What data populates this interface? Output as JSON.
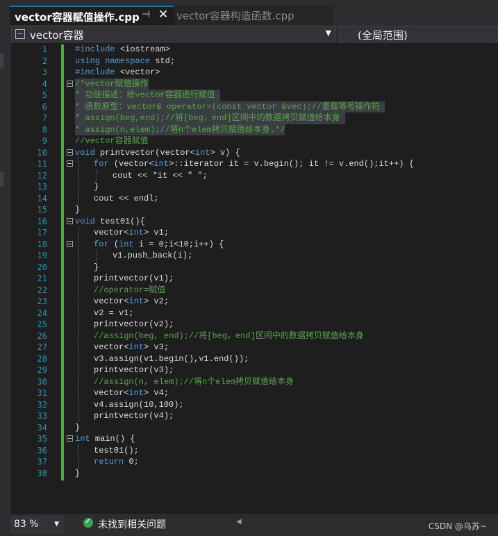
{
  "tabs": {
    "active": {
      "label": "vector容器赋值操作.cpp",
      "pin_icon": "pin-icon",
      "close_icon": "close-icon"
    },
    "inactive": {
      "label": "vector容器构造函数.cpp"
    }
  },
  "navbar": {
    "scope": "vector容器",
    "scope_icon": "project-icon",
    "member": "(全局范围)"
  },
  "colors": {
    "keyword": "#569cd6",
    "comment": "#57a64a",
    "text": "#dcdcdc",
    "line_number": "#2b91af",
    "change_bar": "#57a64a",
    "tab_accent": "#007acc"
  },
  "code": [
    {
      "n": "1",
      "indent": 0,
      "fold": false,
      "hl": false,
      "t": [
        [
          "kw",
          "#include "
        ],
        [
          "tx",
          "<iostream>"
        ]
      ]
    },
    {
      "n": "2",
      "indent": 0,
      "fold": false,
      "hl": false,
      "t": [
        [
          "kw",
          "using namespace "
        ],
        [
          "tx",
          "std;"
        ]
      ]
    },
    {
      "n": "3",
      "indent": 0,
      "fold": false,
      "hl": false,
      "t": [
        [
          "kw",
          "#include "
        ],
        [
          "tx",
          "<vector>"
        ]
      ]
    },
    {
      "n": "4",
      "indent": 0,
      "fold": true,
      "hl": true,
      "t": [
        [
          "cm",
          "/*vector赋值操作"
        ]
      ]
    },
    {
      "n": "5",
      "indent": 0,
      "fold": false,
      "hl": true,
      "t": [
        [
          "cm",
          "* 功能描述：给vector容器进行赋值 "
        ]
      ]
    },
    {
      "n": "6",
      "indent": 0,
      "fold": false,
      "hl": true,
      "t": [
        [
          "cm",
          "* 函数原型：vector& operator=(const vector &vec);//重载等号操作符 "
        ]
      ]
    },
    {
      "n": "7",
      "indent": 0,
      "fold": false,
      "hl": true,
      "t": [
        [
          "cm",
          "* assign(beg,end);//将[beg，end]区间中的数据拷贝赋值给本身 "
        ]
      ]
    },
    {
      "n": "8",
      "indent": 0,
      "fold": false,
      "hl": true,
      "t": [
        [
          "cm",
          "* assign(n,elem);//将n个elem拷贝赋值给本身.*/"
        ]
      ]
    },
    {
      "n": "9",
      "indent": 0,
      "fold": false,
      "hl": false,
      "t": [
        [
          "cm",
          "//vector容器赋值"
        ]
      ]
    },
    {
      "n": "10",
      "indent": 0,
      "fold": true,
      "hl": false,
      "t": [
        [
          "kw",
          "void "
        ],
        [
          "tx",
          "printvector(vector<"
        ],
        [
          "kw",
          "int"
        ],
        [
          "tx",
          "> v) {"
        ]
      ]
    },
    {
      "n": "11",
      "indent": 1,
      "fold": true,
      "hl": false,
      "t": [
        [
          "kw",
          "for "
        ],
        [
          "tx",
          "(vector<"
        ],
        [
          "kw",
          "int"
        ],
        [
          "tx",
          ">::iterator it = v.begin(); it != v.end();it++) {"
        ]
      ]
    },
    {
      "n": "12",
      "indent": 2,
      "fold": false,
      "hl": false,
      "t": [
        [
          "tx",
          "cout << *it << \" \";"
        ]
      ]
    },
    {
      "n": "13",
      "indent": 1,
      "fold": false,
      "hl": false,
      "t": [
        [
          "tx",
          "}"
        ]
      ]
    },
    {
      "n": "14",
      "indent": 1,
      "fold": false,
      "hl": false,
      "t": [
        [
          "tx",
          "cout << endl;"
        ]
      ]
    },
    {
      "n": "15",
      "indent": 0,
      "fold": false,
      "hl": false,
      "t": [
        [
          "tx",
          "}"
        ]
      ]
    },
    {
      "n": "16",
      "indent": 0,
      "fold": true,
      "hl": false,
      "t": [
        [
          "kw",
          "void "
        ],
        [
          "tx",
          "test01(){"
        ]
      ]
    },
    {
      "n": "17",
      "indent": 1,
      "fold": false,
      "hl": false,
      "t": [
        [
          "tx",
          "vector<"
        ],
        [
          "kw",
          "int"
        ],
        [
          "tx",
          "> v1;"
        ]
      ]
    },
    {
      "n": "18",
      "indent": 1,
      "fold": true,
      "hl": false,
      "t": [
        [
          "kw",
          "for "
        ],
        [
          "tx",
          "("
        ],
        [
          "kw",
          "int "
        ],
        [
          "tx",
          "i = 0;i<10;i++) {"
        ]
      ]
    },
    {
      "n": "19",
      "indent": 2,
      "fold": false,
      "hl": false,
      "t": [
        [
          "tx",
          "v1.push_back(i);"
        ]
      ]
    },
    {
      "n": "20",
      "indent": 1,
      "fold": false,
      "hl": false,
      "t": [
        [
          "tx",
          "}"
        ]
      ]
    },
    {
      "n": "21",
      "indent": 1,
      "fold": false,
      "hl": false,
      "t": [
        [
          "tx",
          "printvector(v1);"
        ]
      ]
    },
    {
      "n": "22",
      "indent": 1,
      "fold": false,
      "hl": false,
      "t": [
        [
          "cm",
          "//operator=赋值"
        ]
      ]
    },
    {
      "n": "23",
      "indent": 1,
      "fold": false,
      "hl": false,
      "t": [
        [
          "tx",
          "vector<"
        ],
        [
          "kw",
          "int"
        ],
        [
          "tx",
          "> v2;"
        ]
      ]
    },
    {
      "n": "24",
      "indent": 1,
      "fold": false,
      "hl": false,
      "t": [
        [
          "tx",
          "v2 = v1;"
        ]
      ]
    },
    {
      "n": "25",
      "indent": 1,
      "fold": false,
      "hl": false,
      "t": [
        [
          "tx",
          "printvector(v2);"
        ]
      ]
    },
    {
      "n": "26",
      "indent": 1,
      "fold": false,
      "hl": false,
      "t": [
        [
          "cm",
          "//assign(beg, end);//将[beg，end]区间中的数据拷贝赋值给本身"
        ]
      ]
    },
    {
      "n": "27",
      "indent": 1,
      "fold": false,
      "hl": false,
      "t": [
        [
          "tx",
          "vector<"
        ],
        [
          "kw",
          "int"
        ],
        [
          "tx",
          "> v3;"
        ]
      ]
    },
    {
      "n": "28",
      "indent": 1,
      "fold": false,
      "hl": false,
      "t": [
        [
          "tx",
          "v3.assign(v1.begin(),v1.end());"
        ]
      ]
    },
    {
      "n": "29",
      "indent": 1,
      "fold": false,
      "hl": false,
      "t": [
        [
          "tx",
          "printvector(v3);"
        ]
      ]
    },
    {
      "n": "30",
      "indent": 1,
      "fold": false,
      "hl": false,
      "t": [
        [
          "cm",
          "//assign(n, elem);//将n个elem拷贝赋值给本身"
        ]
      ]
    },
    {
      "n": "31",
      "indent": 1,
      "fold": false,
      "hl": false,
      "t": [
        [
          "tx",
          "vector<"
        ],
        [
          "kw",
          "int"
        ],
        [
          "tx",
          "> v4;"
        ]
      ]
    },
    {
      "n": "32",
      "indent": 1,
      "fold": false,
      "hl": false,
      "t": [
        [
          "tx",
          "v4.assign(10,100);"
        ]
      ]
    },
    {
      "n": "33",
      "indent": 1,
      "fold": false,
      "hl": false,
      "t": [
        [
          "tx",
          "printvector(v4);"
        ]
      ]
    },
    {
      "n": "34",
      "indent": 0,
      "fold": false,
      "hl": false,
      "t": [
        [
          "tx",
          "}"
        ]
      ]
    },
    {
      "n": "35",
      "indent": 0,
      "fold": true,
      "hl": false,
      "t": [
        [
          "kw",
          "int "
        ],
        [
          "tx",
          "main() {"
        ]
      ]
    },
    {
      "n": "36",
      "indent": 1,
      "fold": false,
      "hl": false,
      "t": [
        [
          "tx",
          "test01();"
        ]
      ]
    },
    {
      "n": "37",
      "indent": 1,
      "fold": false,
      "hl": false,
      "t": [
        [
          "kw",
          "return "
        ],
        [
          "tx",
          "0;"
        ]
      ]
    },
    {
      "n": "38",
      "indent": 0,
      "fold": false,
      "hl": false,
      "t": [
        [
          "tx",
          "}"
        ]
      ]
    }
  ],
  "status": {
    "zoom": "83 %",
    "issues_icon": "check-circle-icon",
    "issues": "未找到相关问题",
    "watermark": "CSDN @乌苏~"
  }
}
